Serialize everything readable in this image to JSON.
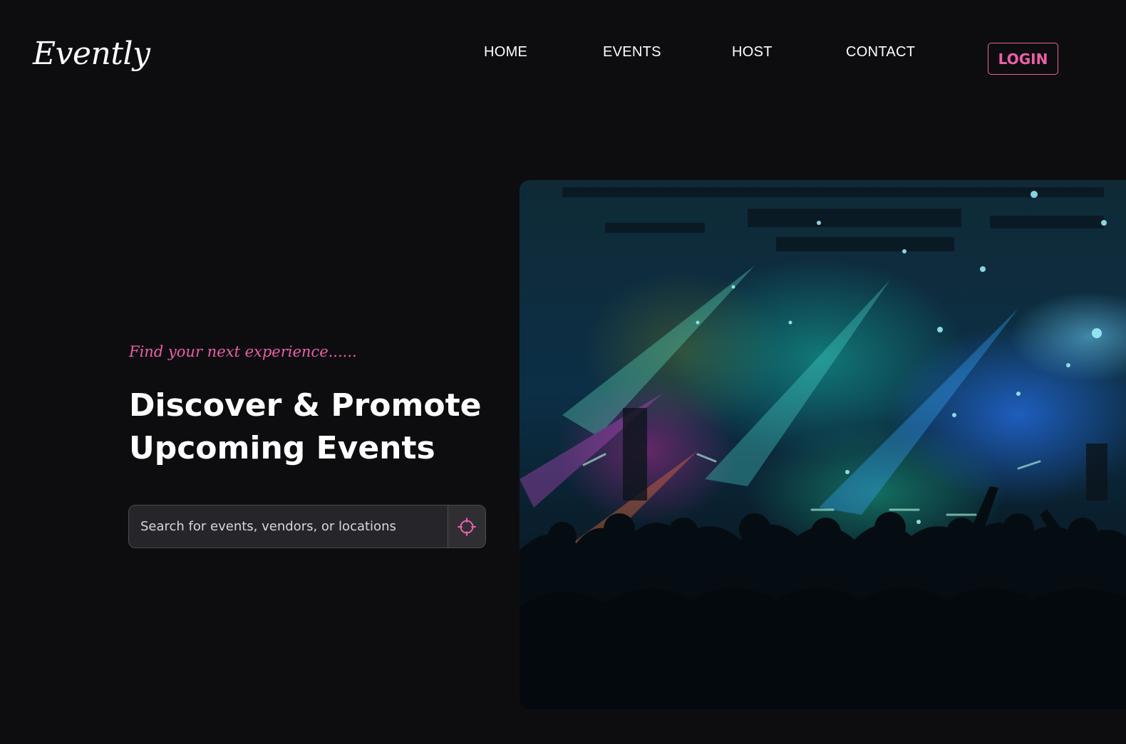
{
  "header": {
    "logo": "Evently",
    "nav": {
      "home": "HOME",
      "events": "EVENTS",
      "host": "HOST",
      "contact": "CONTACT"
    },
    "login_label": "LOGIN"
  },
  "hero": {
    "tagline": "Find your next experience......",
    "headline_line1": "Discover & Promote",
    "headline_line2": "Upcoming Events",
    "search": {
      "placeholder": "Search for events, vendors, or locations",
      "value": ""
    },
    "locate_icon": "crosshair-icon"
  },
  "colors": {
    "background": "#0d0d10",
    "accent": "#ec5fa6",
    "text": "#ffffff",
    "search_bg": "#26262a"
  }
}
